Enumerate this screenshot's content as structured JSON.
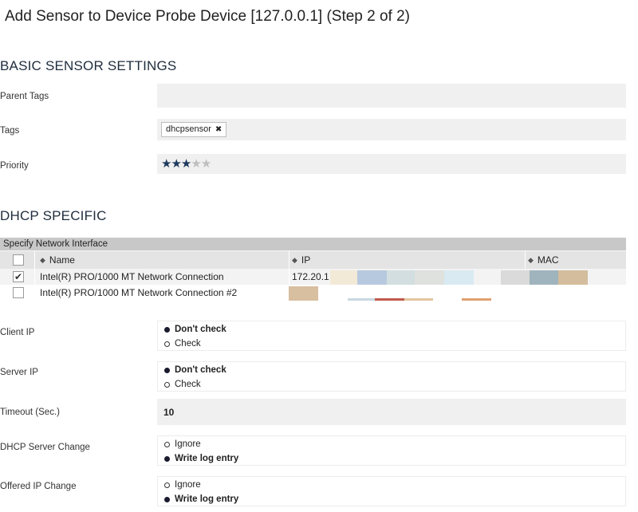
{
  "page_title": "Add Sensor to Device Probe Device [127.0.0.1]  (Step 2 of 2)",
  "basic": {
    "title": "BASIC SENSOR SETTINGS",
    "parent_tags_label": "Parent Tags",
    "tags_label": "Tags",
    "tag_value": "dhcpsensor",
    "priority_label": "Priority",
    "priority_value": 3,
    "priority_max": 5
  },
  "dhcp": {
    "title": "DHCP SPECIFIC",
    "interface_table": {
      "caption": "Specify Network Interface",
      "columns": [
        "Name",
        "IP",
        "MAC"
      ],
      "rows": [
        {
          "checked": true,
          "name": "Intel(R) PRO/1000 MT Network Connection",
          "ip": "172.20.1"
        },
        {
          "checked": false,
          "name": "Intel(R) PRO/1000 MT Network Connection #2",
          "ip": ""
        }
      ]
    },
    "client_ip": {
      "label": "Client IP",
      "options": [
        "Don't check",
        "Check"
      ],
      "selected": 0
    },
    "server_ip": {
      "label": "Server IP",
      "options": [
        "Don't check",
        "Check"
      ],
      "selected": 0
    },
    "timeout": {
      "label": "Timeout (Sec.)",
      "value": "10"
    },
    "server_change": {
      "label": "DHCP Server Change",
      "options": [
        "Ignore",
        "Write log entry"
      ],
      "selected": 1
    },
    "offered_ip_change": {
      "label": "Offered IP Change",
      "options": [
        "Ignore",
        "Write log entry"
      ],
      "selected": 1
    }
  },
  "icons": {
    "sort": "sort-icon",
    "check": "checkmark-icon",
    "remove_tag": "close-icon",
    "star": "star-icon"
  },
  "colors": {
    "star_on": "#1e3a5f",
    "star_off": "#bfbfbf",
    "caption_bg": "#c8c8c8",
    "header_bg": "#e4e4e4"
  }
}
